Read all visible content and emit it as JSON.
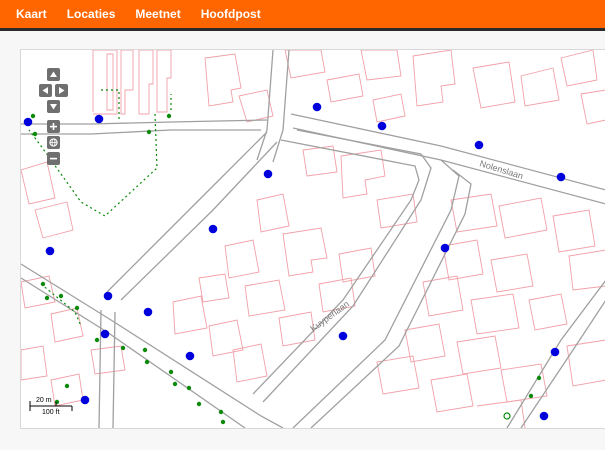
{
  "nav": {
    "items": [
      "Kaart",
      "Locaties",
      "Meetnet",
      "Hoofdpost"
    ]
  },
  "map": {
    "street_labels": [
      "Nolenslaan",
      "Kuyperlaan"
    ],
    "scale": {
      "metric": "20 m",
      "imperial": "100 ft"
    },
    "controls": {
      "pan_up": "pan up",
      "pan_left": "pan left",
      "pan_right": "pan right",
      "pan_down": "pan down",
      "zoom_in": "zoom in",
      "zoom_reset": "zoom to full extent",
      "zoom_out": "zoom out"
    }
  },
  "colors": {
    "header": "#ff6600",
    "header_border": "#2b2b2b",
    "building_outline": "#f2a0a8",
    "road": "#a0a0a0",
    "marker_blue": "#0000dd",
    "marker_green": "#0a8a0a"
  }
}
